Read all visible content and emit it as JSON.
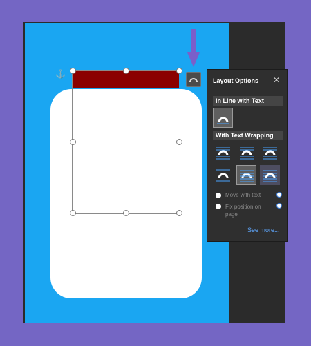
{
  "layout_panel": {
    "title": "Layout Options",
    "close_glyph": "✕",
    "section_inline": "In Line with Text",
    "section_wrapping": "With Text Wrapping",
    "move_with_text": "Move with text",
    "fix_position": "Fix position on page",
    "see_more": "See more..."
  },
  "anchor_glyph": "⚓",
  "colors": {
    "background": "#7466c4",
    "slide": "#1aa6f2",
    "lid": "#8b0000",
    "panel": "#2f2f2f",
    "arrow": "#7b5fc9"
  }
}
